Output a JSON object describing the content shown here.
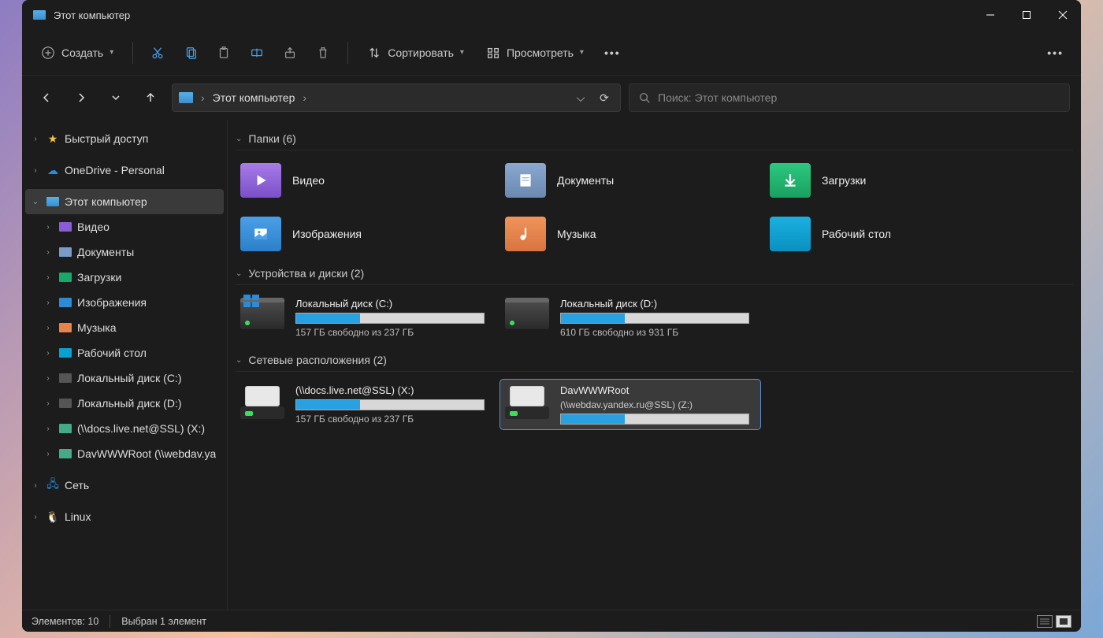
{
  "window": {
    "title": "Этот компьютер"
  },
  "toolbar": {
    "create": "Создать",
    "sort": "Сортировать",
    "view": "Просмотреть"
  },
  "address": {
    "location": "Этот компьютер"
  },
  "search": {
    "placeholder": "Поиск: Этот компьютер"
  },
  "sidebar": {
    "quick_access": "Быстрый доступ",
    "onedrive": "OneDrive - Personal",
    "this_pc": "Этот компьютер",
    "children": {
      "video": "Видео",
      "documents": "Документы",
      "downloads": "Загрузки",
      "pictures": "Изображения",
      "music": "Музыка",
      "desktop": "Рабочий стол",
      "local_c": "Локальный диск (C:)",
      "local_d": "Локальный диск (D:)",
      "netdrv_x": "(\\\\docs.live.net@SSL) (X:)",
      "netdrv_z": "DavWWWRoot (\\\\webdav.ya"
    },
    "network": "Сеть",
    "linux": "Linux"
  },
  "groups": {
    "folders": "Папки (6)",
    "drives": "Устройства и диски (2)",
    "netloc": "Сетевые расположения (2)"
  },
  "folders": {
    "video": "Видео",
    "documents": "Документы",
    "downloads": "Загрузки",
    "pictures": "Изображения",
    "music": "Музыка",
    "desktop": "Рабочий стол"
  },
  "drives": {
    "c": {
      "name": "Локальный диск (C:)",
      "free": "157 ГБ свободно из 237 ГБ",
      "fill_pct": 34
    },
    "d": {
      "name": "Локальный диск (D:)",
      "free": "610 ГБ свободно из 931 ГБ",
      "fill_pct": 34
    }
  },
  "netdrives": {
    "x": {
      "name": "(\\\\docs.live.net@SSL) (X:)",
      "free": "157 ГБ свободно из 237 ГБ",
      "fill_pct": 34
    },
    "z": {
      "name1": "DavWWWRoot",
      "name2": "(\\\\webdav.yandex.ru@SSL) (Z:)",
      "fill_pct": 34
    }
  },
  "status": {
    "count": "Элементов: 10",
    "selection": "Выбран 1 элемент"
  },
  "colors": {
    "video": "#8a5cd6",
    "documents": "#7a9bc8",
    "downloads": "#1aa86a",
    "pictures": "#2c8ad6",
    "music": "#e8844a",
    "desktop": "#0aa0d0"
  }
}
